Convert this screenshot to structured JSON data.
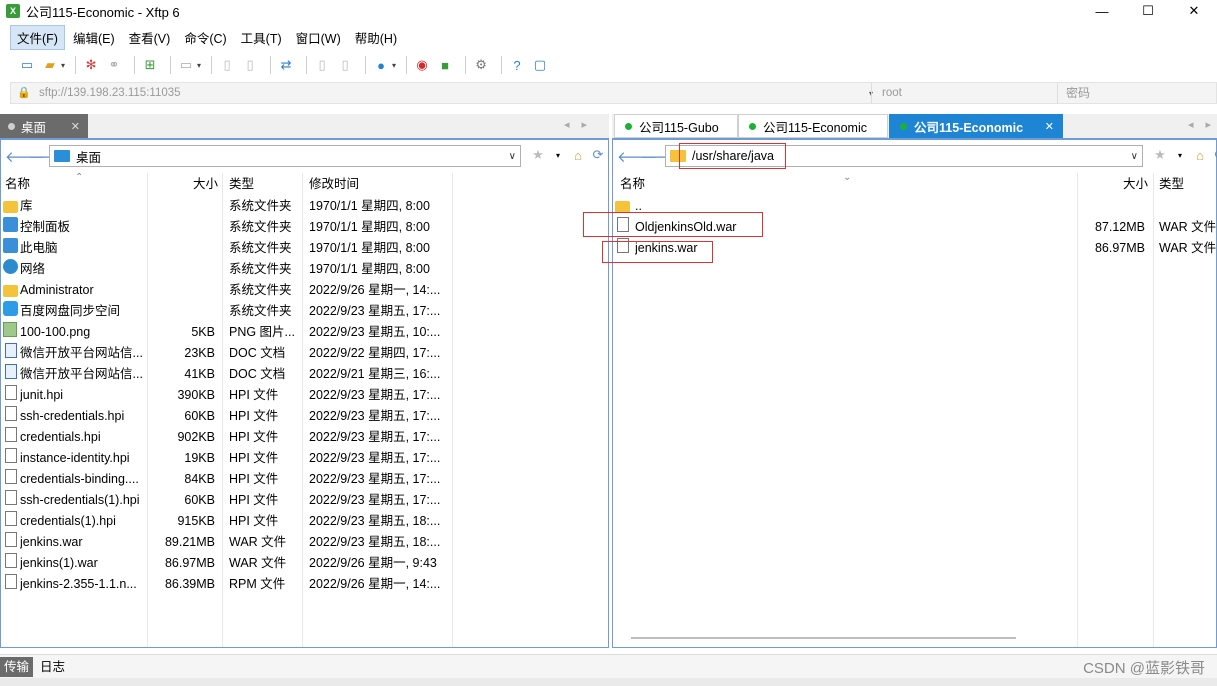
{
  "window": {
    "title": "公司115-Economic    - Xftp 6",
    "controls": [
      "—",
      "☐",
      "✕"
    ]
  },
  "menu": [
    "文件(F)",
    "编辑(E)",
    "查看(V)",
    "命令(C)",
    "工具(T)",
    "窗口(W)",
    "帮助(H)"
  ],
  "toolbar": {
    "icons": [
      "new-session-icon",
      "open-folder-icon",
      "disconnect-icon",
      "reconnect-icon",
      "new-tab-icon",
      "transfer-icon",
      "copy-icon",
      "paste-icon",
      "sync-icon",
      "delete-icon",
      "rename-icon",
      "globe-icon",
      "xshell-icon",
      "xftp-icon",
      "settings-icon",
      "help-icon",
      "chat-icon"
    ]
  },
  "address": {
    "url": "sftp://139.198.23.115:11035",
    "user_placeholder": "root",
    "password_placeholder": "密码"
  },
  "left": {
    "tab": "桌面",
    "path": "桌面",
    "columns": [
      "名称",
      "大小",
      "类型",
      "修改时间"
    ],
    "files": [
      {
        "icon": "folder",
        "name": "库",
        "size": "",
        "type": "系统文件夹",
        "date": "1970/1/1 星期四, 8:00"
      },
      {
        "icon": "sys",
        "name": "控制面板",
        "size": "",
        "type": "系统文件夹",
        "date": "1970/1/1 星期四, 8:00"
      },
      {
        "icon": "sys",
        "name": "此电脑",
        "size": "",
        "type": "系统文件夹",
        "date": "1970/1/1 星期四, 8:00"
      },
      {
        "icon": "net",
        "name": "网络",
        "size": "",
        "type": "系统文件夹",
        "date": "1970/1/1 星期四, 8:00"
      },
      {
        "icon": "folder",
        "name": "Administrator",
        "size": "",
        "type": "系统文件夹",
        "date": "2022/9/26 星期一, 14:..."
      },
      {
        "icon": "cloud",
        "name": "百度网盘同步空间",
        "size": "",
        "type": "系统文件夹",
        "date": "2022/9/23 星期五, 17:..."
      },
      {
        "icon": "png",
        "name": "100-100.png",
        "size": "5KB",
        "type": "PNG 图片...",
        "date": "2022/9/23 星期五, 10:..."
      },
      {
        "icon": "doc",
        "name": "微信开放平台网站信...",
        "size": "23KB",
        "type": "DOC 文档",
        "date": "2022/9/22 星期四, 17:..."
      },
      {
        "icon": "doc",
        "name": "微信开放平台网站信...",
        "size": "41KB",
        "type": "DOC 文档",
        "date": "2022/9/21 星期三, 16:..."
      },
      {
        "icon": "file",
        "name": "junit.hpi",
        "size": "390KB",
        "type": "HPI 文件",
        "date": "2022/9/23 星期五, 17:..."
      },
      {
        "icon": "file",
        "name": "ssh-credentials.hpi",
        "size": "60KB",
        "type": "HPI 文件",
        "date": "2022/9/23 星期五, 17:..."
      },
      {
        "icon": "file",
        "name": "credentials.hpi",
        "size": "902KB",
        "type": "HPI 文件",
        "date": "2022/9/23 星期五, 17:..."
      },
      {
        "icon": "file",
        "name": "instance-identity.hpi",
        "size": "19KB",
        "type": "HPI 文件",
        "date": "2022/9/23 星期五, 17:..."
      },
      {
        "icon": "file",
        "name": "credentials-binding....",
        "size": "84KB",
        "type": "HPI 文件",
        "date": "2022/9/23 星期五, 17:..."
      },
      {
        "icon": "file",
        "name": "ssh-credentials(1).hpi",
        "size": "60KB",
        "type": "HPI 文件",
        "date": "2022/9/23 星期五, 17:..."
      },
      {
        "icon": "file",
        "name": "credentials(1).hpi",
        "size": "915KB",
        "type": "HPI 文件",
        "date": "2022/9/23 星期五, 18:..."
      },
      {
        "icon": "file",
        "name": "jenkins.war",
        "size": "89.21MB",
        "type": "WAR 文件",
        "date": "2022/9/23 星期五, 18:..."
      },
      {
        "icon": "file",
        "name": "jenkins(1).war",
        "size": "86.97MB",
        "type": "WAR 文件",
        "date": "2022/9/26 星期一, 9:43"
      },
      {
        "icon": "file",
        "name": "jenkins-2.355-1.1.n...",
        "size": "86.39MB",
        "type": "RPM 文件",
        "date": "2022/9/26 星期一, 14:..."
      }
    ]
  },
  "right": {
    "tabs": [
      "公司115-Gubo",
      "公司115-Economic",
      "公司115-Economic"
    ],
    "path": "/usr/share/java",
    "columns": [
      "名称",
      "大小",
      "类型"
    ],
    "files": [
      {
        "icon": "folder",
        "name": "..",
        "size": "",
        "type": ""
      },
      {
        "icon": "file",
        "name": "OldjenkinsOld.war",
        "size": "87.12MB",
        "type": "WAR 文件"
      },
      {
        "icon": "file",
        "name": "jenkins.war",
        "size": "86.97MB",
        "type": "WAR 文件"
      }
    ]
  },
  "bottom": {
    "tabs": [
      "传输",
      "日志"
    ],
    "watermark": "CSDN @蓝影铁哥"
  },
  "colors": {
    "accent": "#1e84d4",
    "highlight": "#e23030",
    "status_green": "#1bb135"
  }
}
